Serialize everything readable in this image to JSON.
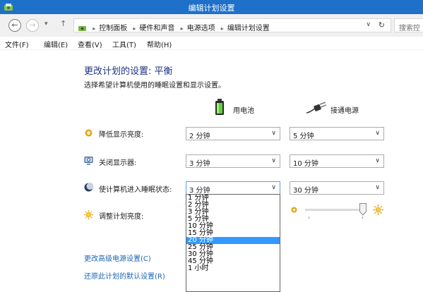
{
  "window": {
    "title": "编辑计划设置"
  },
  "address": {
    "breadcrumbs": [
      "控制面板",
      "硬件和声音",
      "电源选项",
      "编辑计划设置"
    ],
    "search_placeholder": "搜索控"
  },
  "menu": [
    "文件(F)",
    "编辑(E)",
    "查看(V)",
    "工具(T)",
    "帮助(H)"
  ],
  "page": {
    "heading": "更改计划的设置: 平衡",
    "subheading": "选择希望计算机使用的睡眠设置和显示设置。",
    "columns": {
      "battery": "用电池",
      "plugged": "接通电源"
    },
    "rows": [
      {
        "label": "降低显示亮度:",
        "battery": "2 分钟",
        "plugged": "5 分钟"
      },
      {
        "label": "关闭显示器:",
        "battery": "3 分钟",
        "plugged": "10 分钟"
      },
      {
        "label": "使计算机进入睡眠状态:",
        "battery": "3 分钟",
        "plugged": "30 分钟"
      },
      {
        "label": "调整计划亮度:"
      }
    ],
    "brightness_plugged": 1.0,
    "links": {
      "advanced": "更改高级电源设置(C)",
      "restore": "还原此计划的默认设置(R)"
    }
  },
  "dropdown": {
    "options": [
      "1 分钟",
      "2 分钟",
      "3 分钟",
      "5 分钟",
      "10 分钟",
      "15 分钟",
      "20 分钟",
      "25 分钟",
      "30 分钟",
      "45 分钟",
      "1 小时"
    ],
    "selected_index": 6
  },
  "colors": {
    "titlebar": "#1e70c8",
    "heading": "#1e3287",
    "link": "#1e64b4",
    "selection": "#3399ff"
  }
}
